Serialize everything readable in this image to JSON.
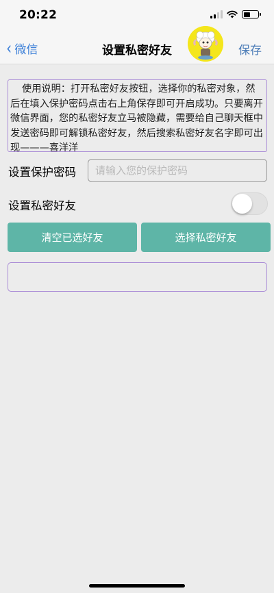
{
  "status_bar": {
    "time": "20:22"
  },
  "nav": {
    "back_label": "微信",
    "title": "设置私密好友",
    "save_label": "保存"
  },
  "instructions": "使用说明：打开私密好友按钮，选择你的私密对象，然后在填入保护密码点击右上角保存即可开启成功。只要离开微信界面，您的私密好友立马被隐藏，需要给自己聊天框中发送密码即可解锁私密好友，然后搜索私密好友名字即可出现———喜洋洋",
  "password": {
    "label": "设置保护密码",
    "placeholder": "请输入您的保护密码",
    "value": ""
  },
  "private_friend": {
    "label": "设置私密好友",
    "toggle_on": false
  },
  "buttons": {
    "clear_label": "清空已选好友",
    "select_label": "选择私密好友"
  },
  "colors": {
    "accent_button": "#5eb5a7",
    "link_blue": "#3b7fd8",
    "border_purple": "#a98bd6"
  }
}
